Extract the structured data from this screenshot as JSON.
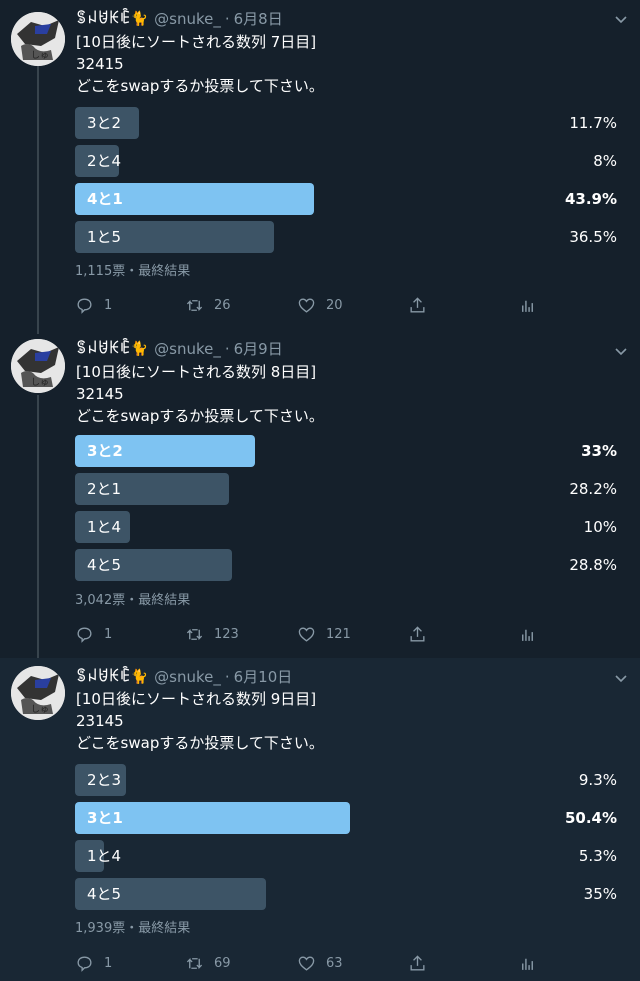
{
  "tweets": [
    {
      "name": "ꌚꈤꐇꀘꍟ🐈",
      "handle": "@snuke_",
      "dot": "·",
      "date": "6月8日",
      "line1": "[10日後にソートされる数列 7日目]",
      "line2": "32415",
      "line3": "どこをswapするか投票して下さい。",
      "poll": [
        {
          "label": "3と2",
          "pct": "11.7%",
          "value": 11.7,
          "winner": false
        },
        {
          "label": "2と4",
          "pct": "8%",
          "value": 8,
          "winner": false
        },
        {
          "label": "4と1",
          "pct": "43.9%",
          "value": 43.9,
          "winner": true
        },
        {
          "label": "1と5",
          "pct": "36.5%",
          "value": 36.5,
          "winner": false
        }
      ],
      "meta": "1,115票・最終結果",
      "replies": "1",
      "retweets": "26",
      "likes": "20"
    },
    {
      "name": "ꌚꈤꐇꀘꍟ🐈",
      "handle": "@snuke_",
      "dot": "·",
      "date": "6月9日",
      "line1": "[10日後にソートされる数列 8日目]",
      "line2": "32145",
      "line3": "どこをswapするか投票して下さい。",
      "poll": [
        {
          "label": "3と2",
          "pct": "33%",
          "value": 33,
          "winner": true
        },
        {
          "label": "2と1",
          "pct": "28.2%",
          "value": 28.2,
          "winner": false
        },
        {
          "label": "1と4",
          "pct": "10%",
          "value": 10,
          "winner": false
        },
        {
          "label": "4と5",
          "pct": "28.8%",
          "value": 28.8,
          "winner": false
        }
      ],
      "meta": "3,042票・最終結果",
      "replies": "1",
      "retweets": "123",
      "likes": "121"
    },
    {
      "name": "ꌚꈤꐇꀘꍟ🐈",
      "handle": "@snuke_",
      "dot": "·",
      "date": "6月10日",
      "line1": "[10日後にソートされる数列 9日目]",
      "line2": "23145",
      "line3": "どこをswapするか投票して下さい。",
      "poll": [
        {
          "label": "2と3",
          "pct": "9.3%",
          "value": 9.3,
          "winner": false
        },
        {
          "label": "3と1",
          "pct": "50.4%",
          "value": 50.4,
          "winner": true
        },
        {
          "label": "1と4",
          "pct": "5.3%",
          "value": 5.3,
          "winner": false
        },
        {
          "label": "4と5",
          "pct": "35%",
          "value": 35,
          "winner": false
        }
      ],
      "meta": "1,939票・最終結果",
      "replies": "1",
      "retweets": "69",
      "likes": "63"
    }
  ],
  "colors": {
    "background": "#15202b",
    "highlight_background": "#192734",
    "winner_bar": "#7ec3f2",
    "bar": "#3d5466",
    "muted_text": "#8899a6"
  },
  "icons": {
    "reply": "reply-icon",
    "retweet": "retweet-icon",
    "like": "heart-icon",
    "share": "share-icon",
    "analytics": "analytics-icon",
    "menu": "chevron-down-icon"
  }
}
